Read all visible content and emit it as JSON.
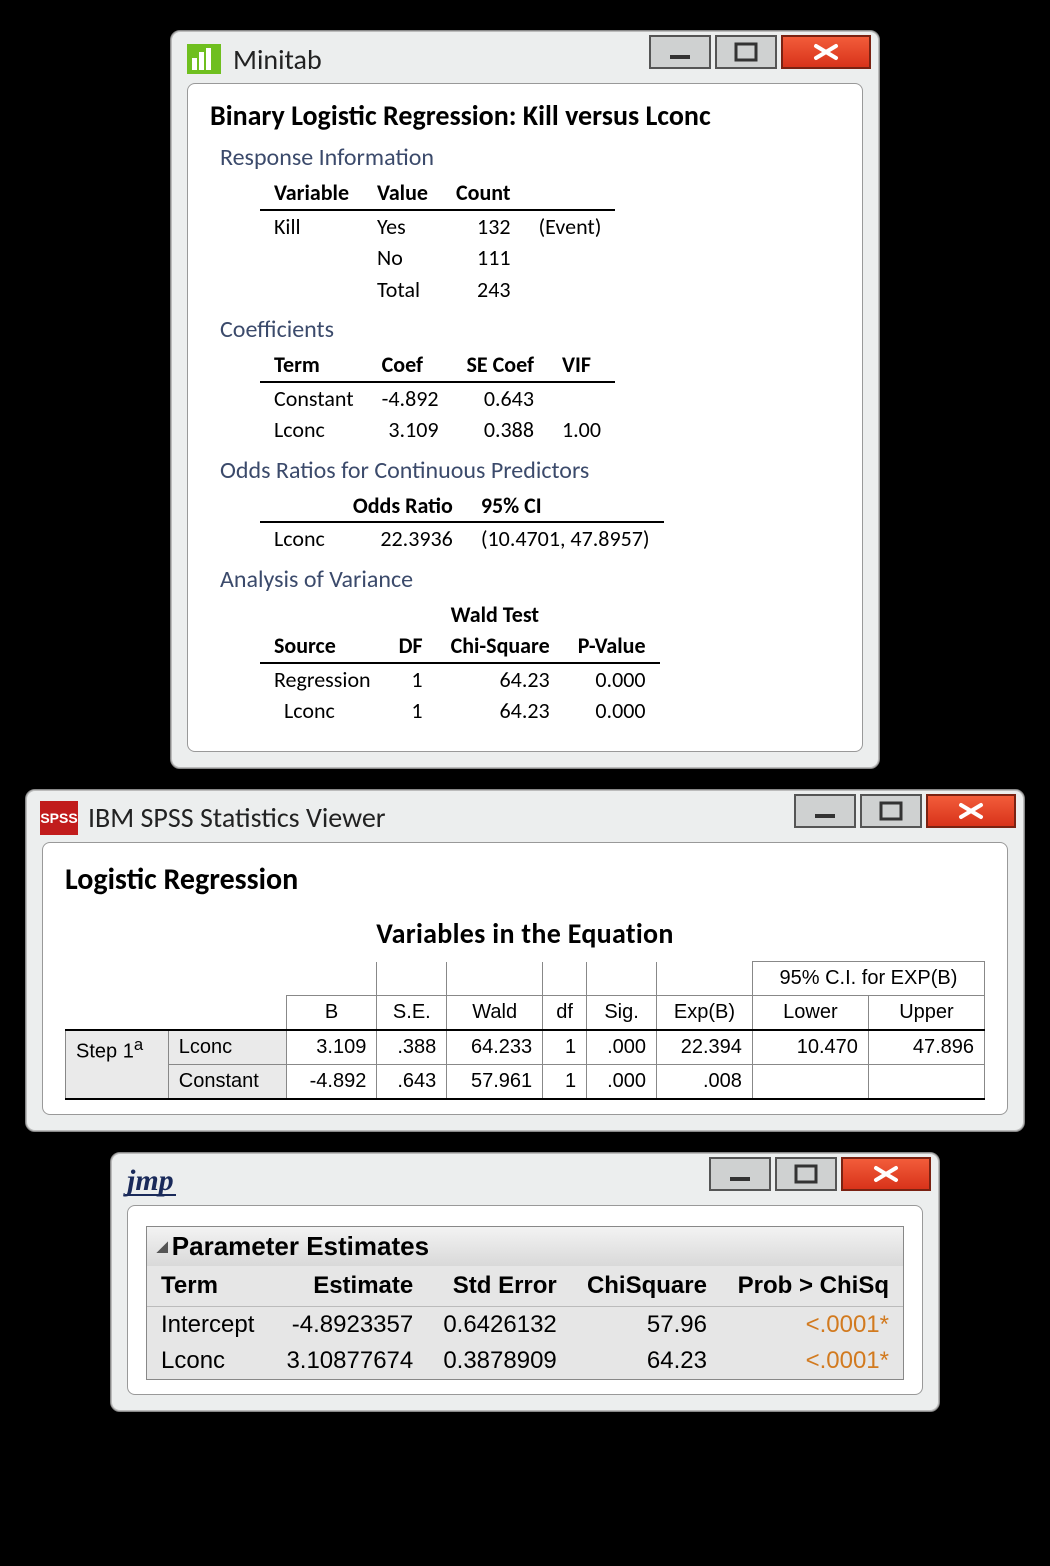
{
  "minitab": {
    "app_title": "Minitab",
    "heading": "Binary Logistic Regression: Kill versus Lconc",
    "response": {
      "title": "Response Information",
      "cols": [
        "Variable",
        "Value",
        "Count"
      ],
      "rows": [
        {
          "variable": "Kill",
          "value": "Yes",
          "count": "132",
          "note": "(Event)"
        },
        {
          "variable": "",
          "value": "No",
          "count": "111",
          "note": ""
        },
        {
          "variable": "",
          "value": "Total",
          "count": "243",
          "note": ""
        }
      ]
    },
    "coefficients": {
      "title": "Coefficients",
      "cols": [
        "Term",
        "Coef",
        "SE Coef",
        "VIF"
      ],
      "rows": [
        {
          "term": "Constant",
          "coef": "-4.892",
          "se": "0.643",
          "vif": ""
        },
        {
          "term": "Lconc",
          "coef": "3.109",
          "se": "0.388",
          "vif": "1.00"
        }
      ]
    },
    "odds": {
      "title": "Odds Ratios for Continuous Predictors",
      "cols": [
        "",
        "Odds Ratio",
        "95% CI"
      ],
      "rows": [
        {
          "term": "Lconc",
          "ratio": "22.3936",
          "ci": "(10.4701, 47.8957)"
        }
      ]
    },
    "anova": {
      "title": "Analysis of Variance",
      "super": "Wald Test",
      "cols": [
        "Source",
        "DF",
        "Chi-Square",
        "P-Value"
      ],
      "rows": [
        {
          "source": "Regression",
          "df": "1",
          "chi": "64.23",
          "p": "0.000"
        },
        {
          "source": "Lconc",
          "df": "1",
          "chi": "64.23",
          "p": "0.000"
        }
      ]
    }
  },
  "spss": {
    "app_title": "IBM SPSS Statistics Viewer",
    "heading": "Logistic Regression",
    "subheading": "Variables in the Equation",
    "ci_header": "95% C.I. for EXP(B)",
    "cols": [
      "B",
      "S.E.",
      "Wald",
      "df",
      "Sig.",
      "Exp(B)",
      "Lower",
      "Upper"
    ],
    "step_label": "Step 1",
    "step_sup": "a",
    "rows": [
      {
        "name": "Lconc",
        "b": "3.109",
        "se": ".388",
        "wald": "64.233",
        "df": "1",
        "sig": ".000",
        "expb": "22.394",
        "low": "10.470",
        "up": "47.896"
      },
      {
        "name": "Constant",
        "b": "-4.892",
        "se": ".643",
        "wald": "57.961",
        "df": "1",
        "sig": ".000",
        "expb": ".008",
        "low": "",
        "up": ""
      }
    ]
  },
  "jmp": {
    "app_title_logo": "jmp",
    "panel_title": "Parameter Estimates",
    "cols": [
      "Term",
      "Estimate",
      "Std Error",
      "ChiSquare",
      "Prob > ChiSq"
    ],
    "rows": [
      {
        "term": "Intercept",
        "est": "-4.8923357",
        "se": "0.6426132",
        "chi": "57.96",
        "p": "<.0001*"
      },
      {
        "term": "Lconc",
        "est": "3.10877674",
        "se": "0.3878909",
        "chi": "64.23",
        "p": "<.0001*"
      }
    ]
  }
}
